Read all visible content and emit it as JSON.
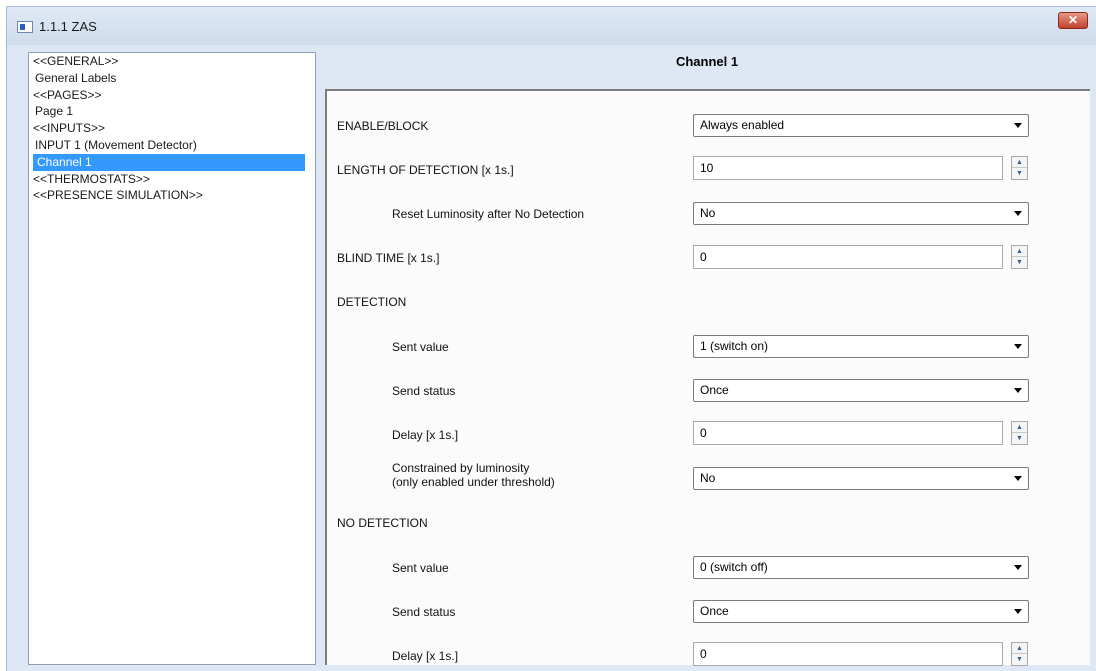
{
  "window": {
    "title": "1.1.1 ZAS",
    "close_label": "✕"
  },
  "tree": {
    "items": [
      {
        "label": "<<GENERAL>>"
      },
      {
        "label": "General Labels"
      },
      {
        "label": "<<PAGES>>"
      },
      {
        "label": "Page 1"
      },
      {
        "label": "<<INPUTS>>"
      },
      {
        "label": "INPUT 1 (Movement Detector)"
      },
      {
        "label": "Channel 1",
        "selected": true
      },
      {
        "label": "<<THERMOSTATS>>"
      },
      {
        "label": "<<PRESENCE SIMULATION>>"
      }
    ]
  },
  "pane": {
    "title": "Channel 1",
    "enable_block": {
      "label": "ENABLE/BLOCK",
      "value": "Always enabled"
    },
    "length_detection": {
      "label": "LENGTH OF DETECTION [x 1s.]",
      "value": "10"
    },
    "reset_luminosity": {
      "label": "Reset Luminosity after No Detection",
      "value": "No"
    },
    "blind_time": {
      "label": "BLIND TIME [x 1s.]",
      "value": "0"
    },
    "detection": {
      "heading": "DETECTION",
      "sent_value": {
        "label": "Sent value",
        "value": "1 (switch on)"
      },
      "send_status": {
        "label": "Send status",
        "value": "Once"
      },
      "delay": {
        "label": "Delay [x 1s.]",
        "value": "0"
      },
      "constrained": {
        "label_line1": "Constrained by luminosity",
        "label_line2": "(only enabled under threshold)",
        "value": "No"
      }
    },
    "no_detection": {
      "heading": "NO DETECTION",
      "sent_value": {
        "label": "Sent value",
        "value": "0 (switch off)"
      },
      "send_status": {
        "label": "Send status",
        "value": "Once"
      },
      "delay": {
        "label": "Delay [x 1s.]",
        "value": "0"
      }
    }
  },
  "icons": {
    "app": "app-window-icon",
    "close": "close-icon",
    "dropdown": "chevron-down-icon",
    "spin_up": "spin-up-icon",
    "spin_down": "spin-down-icon"
  }
}
